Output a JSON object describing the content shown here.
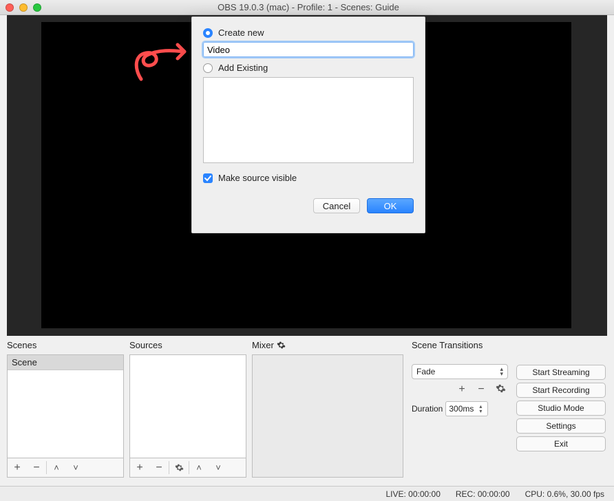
{
  "window": {
    "title": "OBS 19.0.3 (mac) - Profile: 1 - Scenes: Guide"
  },
  "dialog": {
    "create_new": "Create new",
    "add_existing": "Add Existing",
    "name_value": "Video",
    "make_visible": "Make source visible",
    "cancel": "Cancel",
    "ok": "OK"
  },
  "panels": {
    "scenes_label": "Scenes",
    "sources_label": "Sources",
    "mixer_label": "Mixer",
    "transitions_label": "Scene Transitions"
  },
  "scenes": {
    "items": [
      "Scene"
    ]
  },
  "transitions": {
    "selected": "Fade",
    "duration_label": "Duration",
    "duration_value": "300ms"
  },
  "buttons": {
    "start_streaming": "Start Streaming",
    "start_recording": "Start Recording",
    "studio_mode": "Studio Mode",
    "settings": "Settings",
    "exit": "Exit"
  },
  "status": {
    "live": "LIVE: 00:00:00",
    "rec": "REC: 00:00:00",
    "cpu": "CPU: 0.6%, 30.00 fps"
  }
}
